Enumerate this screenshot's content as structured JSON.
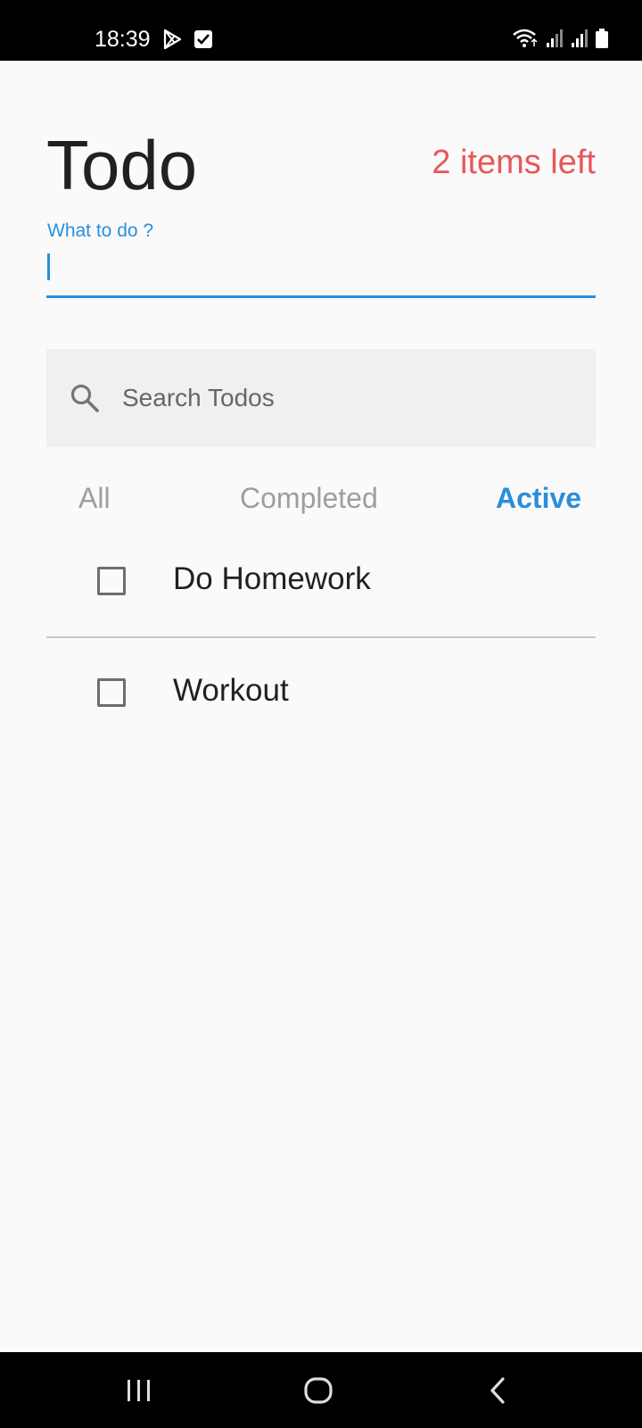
{
  "status_bar": {
    "time": "18:39",
    "left_icons": [
      "play-store-icon",
      "checkbox-notification-icon"
    ],
    "right_icons": [
      "wifi-icon",
      "signal-icon",
      "signal-icon",
      "battery-icon"
    ]
  },
  "header": {
    "title": "Todo",
    "items_left": "2 items left",
    "items_left_color": "#e8575a"
  },
  "todo_input": {
    "label": "What to do ?",
    "value": "",
    "accent_color": "#2a8edb"
  },
  "search": {
    "icon": "search-icon",
    "placeholder": "Search Todos"
  },
  "filters": {
    "tabs": [
      {
        "label": "All",
        "selected": false
      },
      {
        "label": "Completed",
        "selected": false
      },
      {
        "label": "Active",
        "selected": true
      }
    ]
  },
  "todos": [
    {
      "text": "Do Homework",
      "completed": false
    },
    {
      "text": "Workout",
      "completed": false
    }
  ],
  "nav_bar": {
    "buttons": [
      "recent-apps-icon",
      "home-icon",
      "back-icon"
    ]
  }
}
